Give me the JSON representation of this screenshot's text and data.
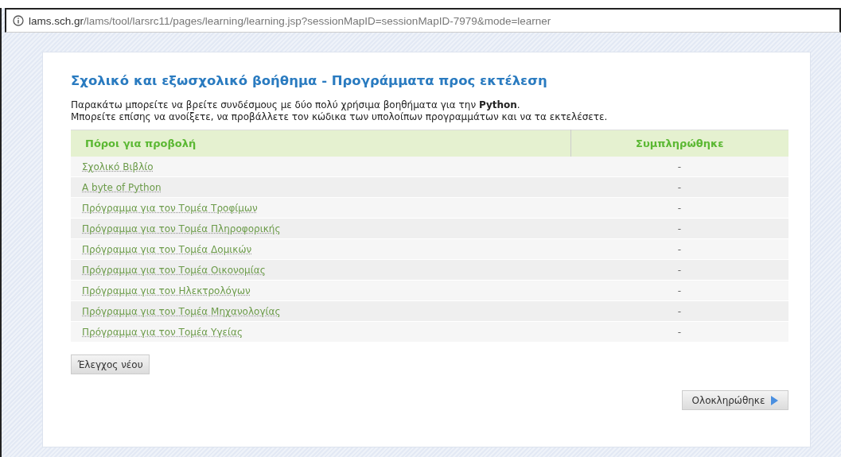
{
  "address_bar": {
    "host": "lams.sch.gr",
    "path": "/lams/tool/larsrc11/pages/learning/learning.jsp?sessionMapID=sessionMapID-7979&mode=learner"
  },
  "title": "Σχολικό και εξωσχολικό βοήθημα - Προγράμματα προς εκτέλεση",
  "instructions": [
    "Παρακάτω μπορείτε να βρείτε συνδέσμους με δύο πολύ χρήσιμα βοηθήματα για την **Python**.",
    "Μπορείτε επίσης να ανοίξετε, να προβάλλετε τον κώδικα των υπολοίπων προγραμμάτων και να τα εκτελέσετε."
  ],
  "table": {
    "columns": [
      "Πόροι για προβολή",
      "Συμπληρώθηκε"
    ],
    "rows": [
      {
        "resource": "Σχολικό Βιβλίο",
        "completed": "-"
      },
      {
        "resource": "A byte of Python",
        "completed": "-"
      },
      {
        "resource": "Πρόγραμμα για τον Τομέα Τροφίμων",
        "completed": "-"
      },
      {
        "resource": "Πρόγραμμα για τον Τομέα Πληροφορικής",
        "completed": "-"
      },
      {
        "resource": "Πρόγραμμα για τον Τομέα Δομικών",
        "completed": "-"
      },
      {
        "resource": "Πρόγραμμα για τον Τομέα Οικονομίας",
        "completed": "-"
      },
      {
        "resource": "Πρόγραμμα για τον Ηλεκτρολόγων",
        "completed": "-"
      },
      {
        "resource": "Πρόγραμμα για τον Τομέα Μηχανολογίας",
        "completed": "-"
      },
      {
        "resource": "Πρόγραμμα για τον Τομέα Υγείας",
        "completed": "-"
      }
    ]
  },
  "buttons": [
    {
      "label": "Έλεγχος νέου",
      "kind": "plain"
    },
    {
      "label": "Ολοκληρώθηκε",
      "kind": "next"
    }
  ]
}
